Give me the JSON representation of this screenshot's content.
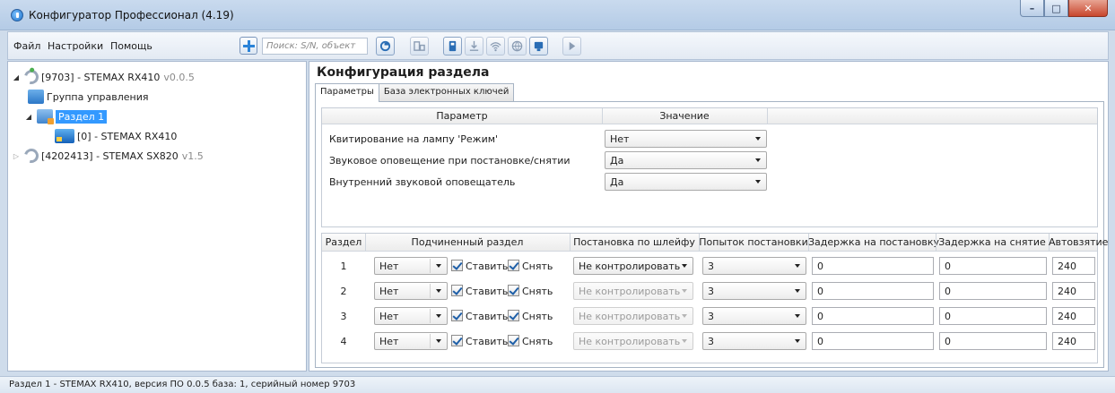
{
  "window": {
    "title": "Конфигуратор Профессионал (4.19)",
    "min": "–",
    "max": "□",
    "close": "✕"
  },
  "menu": [
    "Файл",
    "Настройки",
    "Помощь"
  ],
  "search": {
    "placeholder": "Поиск: S/N, объект"
  },
  "toolbar_icons": [
    "connect-icon",
    "device-icon",
    "usb-icon",
    "download-icon",
    "wifi-icon",
    "globe-icon",
    "chip-icon",
    "play-icon"
  ],
  "tree": {
    "nodes": [
      {
        "label": "[9703] - STEMAX RX410",
        "version": "v0.0.5"
      },
      {
        "label": "Группа управления"
      },
      {
        "label": "Раздел 1"
      },
      {
        "label": "[0] - STEMAX RX410"
      },
      {
        "label": "[4202413] - STEMAX SX820",
        "version": "v1.5"
      }
    ]
  },
  "page": {
    "title": "Конфигурация раздела",
    "tabs": [
      "Параметры",
      "База электронных ключей"
    ]
  },
  "params": {
    "headers": [
      "Параметр",
      "Значение"
    ],
    "rows": [
      {
        "label": "Квитирование на лампу 'Режим'",
        "value": "Нет"
      },
      {
        "label": "Звуковое оповещение при постановке/снятии",
        "value": "Да"
      },
      {
        "label": "Внутренний звуковой оповещатель",
        "value": "Да"
      }
    ]
  },
  "sections": {
    "headers": [
      "Раздел",
      "Подчиненный раздел",
      "Постановка по шлейфу",
      "Попыток постановки",
      "Задержка на постановку",
      "Задержка на снятие",
      "Автовзятие"
    ],
    "check_arm": "Ставить",
    "check_disarm": "Снять",
    "rows": [
      {
        "num": "1",
        "sub": "Нет",
        "loop": "Не контролировать",
        "attempts": "3",
        "arm_delay": "0",
        "disarm_delay": "0",
        "auto": "240"
      },
      {
        "num": "2",
        "sub": "Нет",
        "loop": "Не контролировать",
        "attempts": "3",
        "arm_delay": "0",
        "disarm_delay": "0",
        "auto": "240"
      },
      {
        "num": "3",
        "sub": "Нет",
        "loop": "Не контролировать",
        "attempts": "3",
        "arm_delay": "0",
        "disarm_delay": "0",
        "auto": "240"
      },
      {
        "num": "4",
        "sub": "Нет",
        "loop": "Не контролировать",
        "attempts": "3",
        "arm_delay": "0",
        "disarm_delay": "0",
        "auto": "240"
      }
    ]
  },
  "status": "Раздел 1 - STEMAX RX410, версия ПО 0.0.5 база: 1, серийный номер 9703"
}
